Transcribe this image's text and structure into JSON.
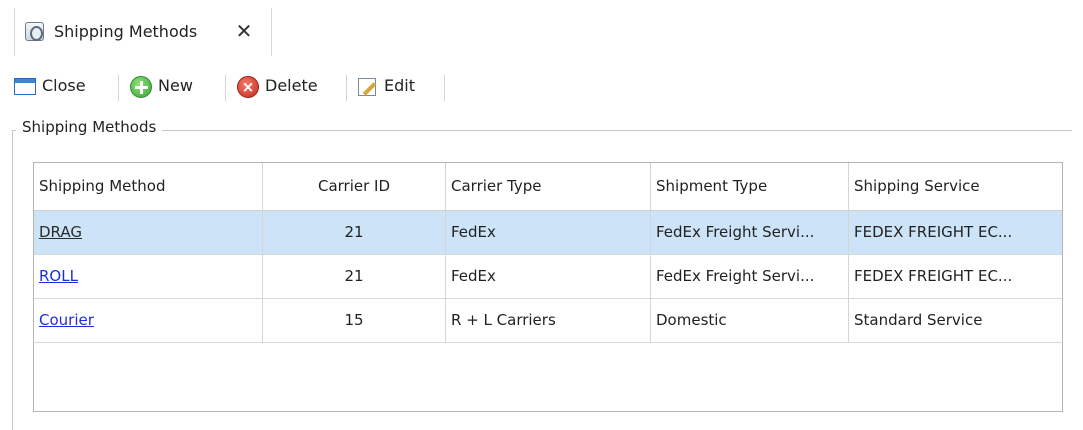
{
  "tab": {
    "label": "Shipping Methods",
    "close_glyph": "✕",
    "icon": "shipping-icon"
  },
  "toolbar": {
    "close_label": "Close",
    "new_label": "New",
    "delete_label": "Delete",
    "edit_label": "Edit"
  },
  "group": {
    "title": "Shipping Methods"
  },
  "grid": {
    "columns": [
      "Shipping Method",
      "Carrier ID",
      "Carrier Type",
      "Shipment Type",
      "Shipping Service"
    ],
    "rows": [
      {
        "method": "DRAG",
        "carrier_id": "21",
        "carrier_type": "FedEx",
        "shipment_type": "FedEx Freight Servi...",
        "shipping_service": "FEDEX FREIGHT EC...",
        "selected": true
      },
      {
        "method": "ROLL",
        "carrier_id": "21",
        "carrier_type": "FedEx",
        "shipment_type": "FedEx Freight Servi...",
        "shipping_service": "FEDEX FREIGHT EC...",
        "selected": false
      },
      {
        "method": "Courier",
        "carrier_id": "15",
        "carrier_type": "R + L Carriers",
        "shipment_type": "Domestic",
        "shipping_service": "Standard Service",
        "selected": false
      }
    ]
  },
  "colors": {
    "selection": "#cde3f7",
    "link": "#1a31d6"
  }
}
